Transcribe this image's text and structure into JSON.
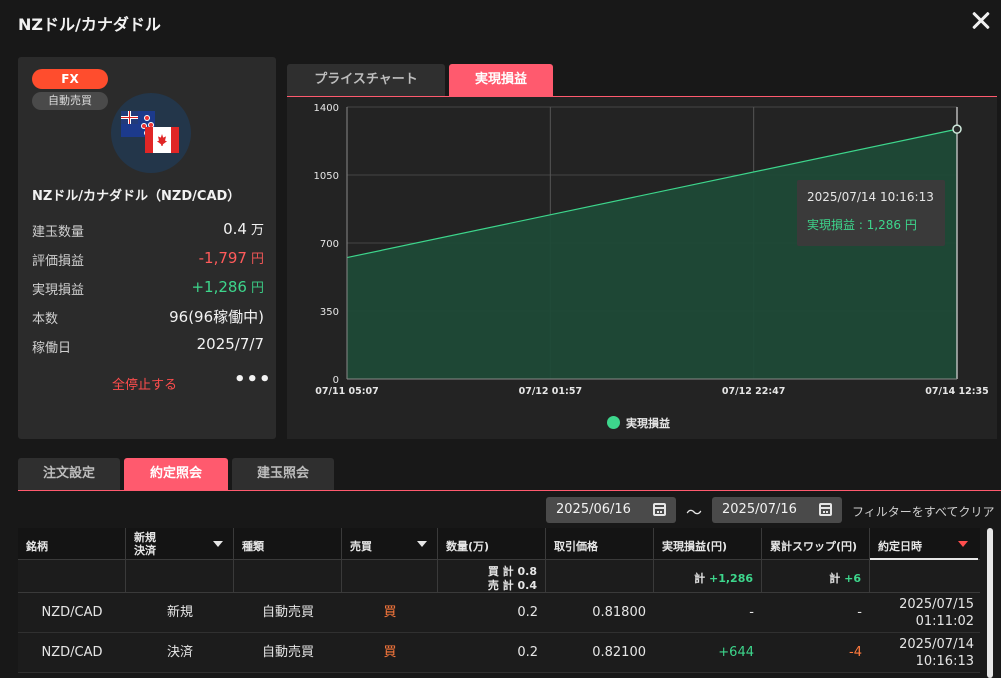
{
  "window": {
    "title": "NZドル/カナダドル"
  },
  "card": {
    "badge_type": "FX",
    "badge_mode": "自動売買",
    "pair_name": "NZドル/カナダドル（NZD/CAD）",
    "rows": [
      {
        "label": "建玉数量",
        "value": "0.4",
        "unit": "万",
        "tone": "normal"
      },
      {
        "label": "評価損益",
        "value": "-1,797",
        "unit": "円",
        "tone": "red"
      },
      {
        "label": "実現損益",
        "value": "+1,286",
        "unit": "円",
        "tone": "green"
      },
      {
        "label": "本数",
        "value": "96(96稼働中)",
        "unit": "",
        "tone": "normal"
      },
      {
        "label": "稼働日",
        "value": "2025/7/7",
        "unit": "",
        "tone": "normal"
      }
    ],
    "stop_all_label": "全停止する",
    "more_label": "•••"
  },
  "chart_tabs": [
    {
      "label": "プライスチャート",
      "active": false
    },
    {
      "label": "実現損益",
      "active": true
    }
  ],
  "chart_data": {
    "type": "area",
    "x": [
      "07/11 05:07",
      "07/14 10:16"
    ],
    "values": [
      625,
      1286
    ],
    "ylim": [
      0,
      1400
    ],
    "yticks": [
      0,
      350,
      700,
      1050,
      1400
    ],
    "xtick_labels": [
      "07/11 05:07",
      "07/12 01:57",
      "07/12 22:47",
      "07/14 12:35"
    ],
    "series_name": "実現損益",
    "grid": true,
    "legend_position": "bottom-center",
    "fill_color": "#1f4a37",
    "line_color": "#3dd68c",
    "tooltip": {
      "time": "2025/07/14 10:16:13",
      "text": "実現損益 : 1,286 円"
    }
  },
  "bottom_tabs": [
    {
      "label": "注文設定",
      "active": false
    },
    {
      "label": "約定照会",
      "active": true
    },
    {
      "label": "建玉照会",
      "active": false
    }
  ],
  "filter": {
    "date_from": "2025/06/16",
    "tilde": "〜",
    "date_to": "2025/07/16",
    "clear_label": "フィルターをすべてクリア"
  },
  "table": {
    "headers": {
      "symbol": "銘柄",
      "new_close_1": "新規",
      "new_close_2": "決済",
      "type": "種類",
      "side": "売買",
      "qty": "数量(万)",
      "price": "取引価格",
      "pnl": "実現損益(円)",
      "swap": "累計スワップ(円)",
      "time": "約定日時"
    },
    "summary": {
      "buy_total": "買 計 0.8",
      "sell_total": "売 計 0.4",
      "pnl_total_label": "計 ",
      "pnl_total_value": "+1,286",
      "swap_total_label": "計 ",
      "swap_total_value": "+6"
    },
    "rows": [
      {
        "symbol": "NZD/CAD",
        "kind": "新規",
        "type": "自動売買",
        "side": "買",
        "qty": "0.2",
        "price": "0.81800",
        "pnl": "-",
        "swap": "-",
        "date": "2025/07/15",
        "time": "01:11:02"
      },
      {
        "symbol": "NZD/CAD",
        "kind": "決済",
        "type": "自動売買",
        "side": "買",
        "qty": "0.2",
        "price": "0.82100",
        "pnl": "+644",
        "swap": "-4",
        "date": "2025/07/14",
        "time": "10:16:13"
      }
    ]
  },
  "colors": {
    "accent": "#ff5a6e",
    "green": "#3dd68c",
    "red": "#ff5a5a",
    "badge": "#ff4d2d"
  }
}
